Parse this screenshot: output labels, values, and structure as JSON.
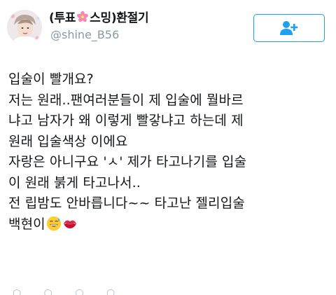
{
  "profile": {
    "display_name_prefix": "(투표",
    "display_name_icon": "cherry-blossom-icon",
    "display_name_suffix": "스밍)환절기",
    "handle": "@shine_B56"
  },
  "follow_button": {
    "icon": "add-user-icon",
    "color": "#1da1f2"
  },
  "tweet": {
    "lines": [
      "입술이 빨개요?",
      "저는 원래..팬여러분들이 제 입술에 뭘바르",
      "냐고 남자가 왜 이렇게 빨갛냐고 하는데 제",
      "원래 입술색상 이에요",
      "자랑은 아니구요 'ㅅ' 제가 타고나기를 입술",
      "이 원래 붉게 타고나서..",
      "전 립밤도 안바릅니다~~ 타고난 젤리입술",
      "백현이"
    ],
    "trailing_emojis": [
      "grinning-sweat-emoji",
      "kiss-mark-emoji"
    ]
  },
  "colors": {
    "text": "#14171a",
    "secondary": "#8899a6",
    "accent": "#1da1f2"
  }
}
